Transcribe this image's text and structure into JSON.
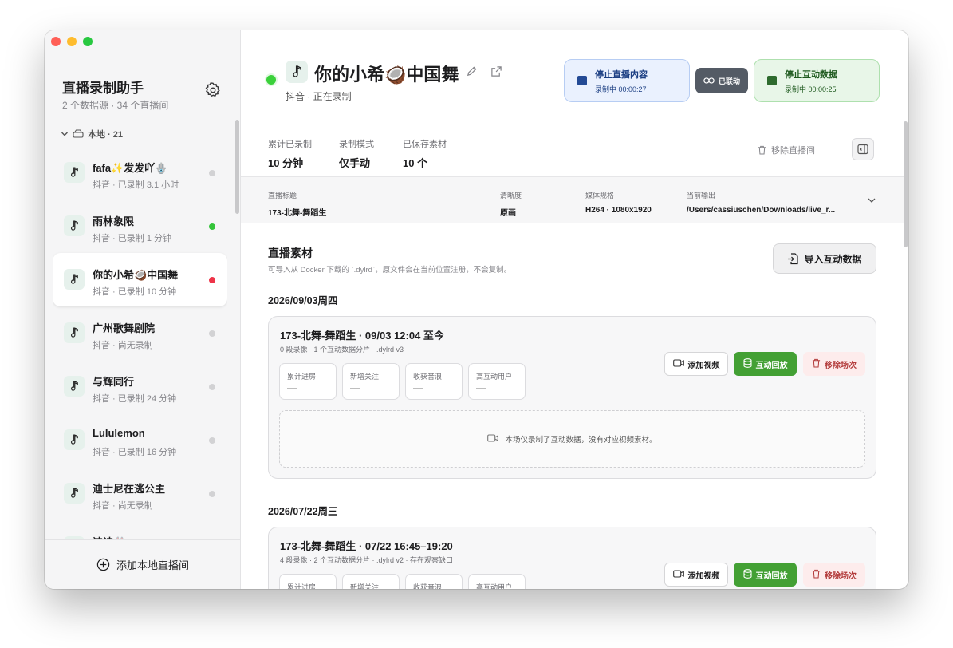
{
  "sidebar": {
    "app_title": "直播录制助手",
    "app_subtitle": "2 个数据源 · 34 个直播间",
    "group_label": "本地 · 21",
    "add_label": "添加本地直播间",
    "items": [
      {
        "name": "fafa✨发发吖🪬",
        "meta": "抖音 · 已录制 3.1 小时",
        "status": "idle"
      },
      {
        "name": "雨林象限",
        "meta": "抖音 · 已录制 1 分钟",
        "status": "green"
      },
      {
        "name": "你的小希🥥中国舞",
        "meta": "抖音 · 已录制 10 分钟",
        "status": "red"
      },
      {
        "name": "广州歌舞剧院",
        "meta": "抖音 · 尚无录制",
        "status": "idle"
      },
      {
        "name": "与辉同行",
        "meta": "抖音 · 已录制 24 分钟",
        "status": "idle"
      },
      {
        "name": "Lululemon",
        "meta": "抖音 · 已录制 16 分钟",
        "status": "idle"
      },
      {
        "name": "迪士尼在逃公主",
        "meta": "抖音 · 尚无录制",
        "status": "idle"
      },
      {
        "name": "诗诗🐰",
        "meta": "",
        "status": "idle"
      }
    ]
  },
  "header": {
    "title": "你的小希🥥中国舞",
    "subtitle": "抖音 · 正在录制",
    "stop_content_label": "停止直播内容",
    "stop_content_time": "录制中 00:00:27",
    "linked_label": "已联动",
    "stop_interact_label": "停止互动数据",
    "stop_interact_time": "录制中 00:00:25"
  },
  "stats": {
    "total_label": "累计已录制",
    "total_value": "10 分钟",
    "mode_label": "录制模式",
    "mode_value": "仅手动",
    "saved_label": "已保存素材",
    "saved_value": "10 个",
    "remove_label": "移除直播间"
  },
  "meta": {
    "title_label": "直播标题",
    "title_value": "173-北舞-舞蹈生",
    "quality_label": "清晰度",
    "quality_value": "原画",
    "media_label": "媒体规格",
    "media_value": "H264 · 1080x1920",
    "output_label": "当前输出",
    "output_value": "/Users/cassiuschen/Downloads/live_r..."
  },
  "materials": {
    "title": "直播素材",
    "desc": "可导入从 Docker 下载的 `.dylrd`，原文件会在当前位置注册，不会复制。",
    "import_label": "导入互动数据"
  },
  "metric_labels": [
    "累计进房",
    "新增关注",
    "收获音浪",
    "高互动用户"
  ],
  "actions": {
    "add_video": "添加视频",
    "replay": "互动回放",
    "remove": "移除场次"
  },
  "sessions": [
    {
      "date": "2026/09/03周四",
      "title": "173-北舞-舞蹈生 · 09/03 12:04 至今",
      "sub": "0 段录像 · 1 个互动数据分片 · .dylrd v3",
      "metrics": [
        "—",
        "—",
        "—",
        "—"
      ],
      "empty_note": "本场仅录制了互动数据，没有对应视频素材。"
    },
    {
      "date": "2026/07/22周三",
      "title": "173-北舞-舞蹈生 · 07/22 16:45–19:20",
      "sub": "4 段录像 · 2 个互动数据分片 · .dylrd v2 · 存在观察缺口",
      "metrics": [
        "",
        "",
        "",
        ""
      ]
    }
  ]
}
